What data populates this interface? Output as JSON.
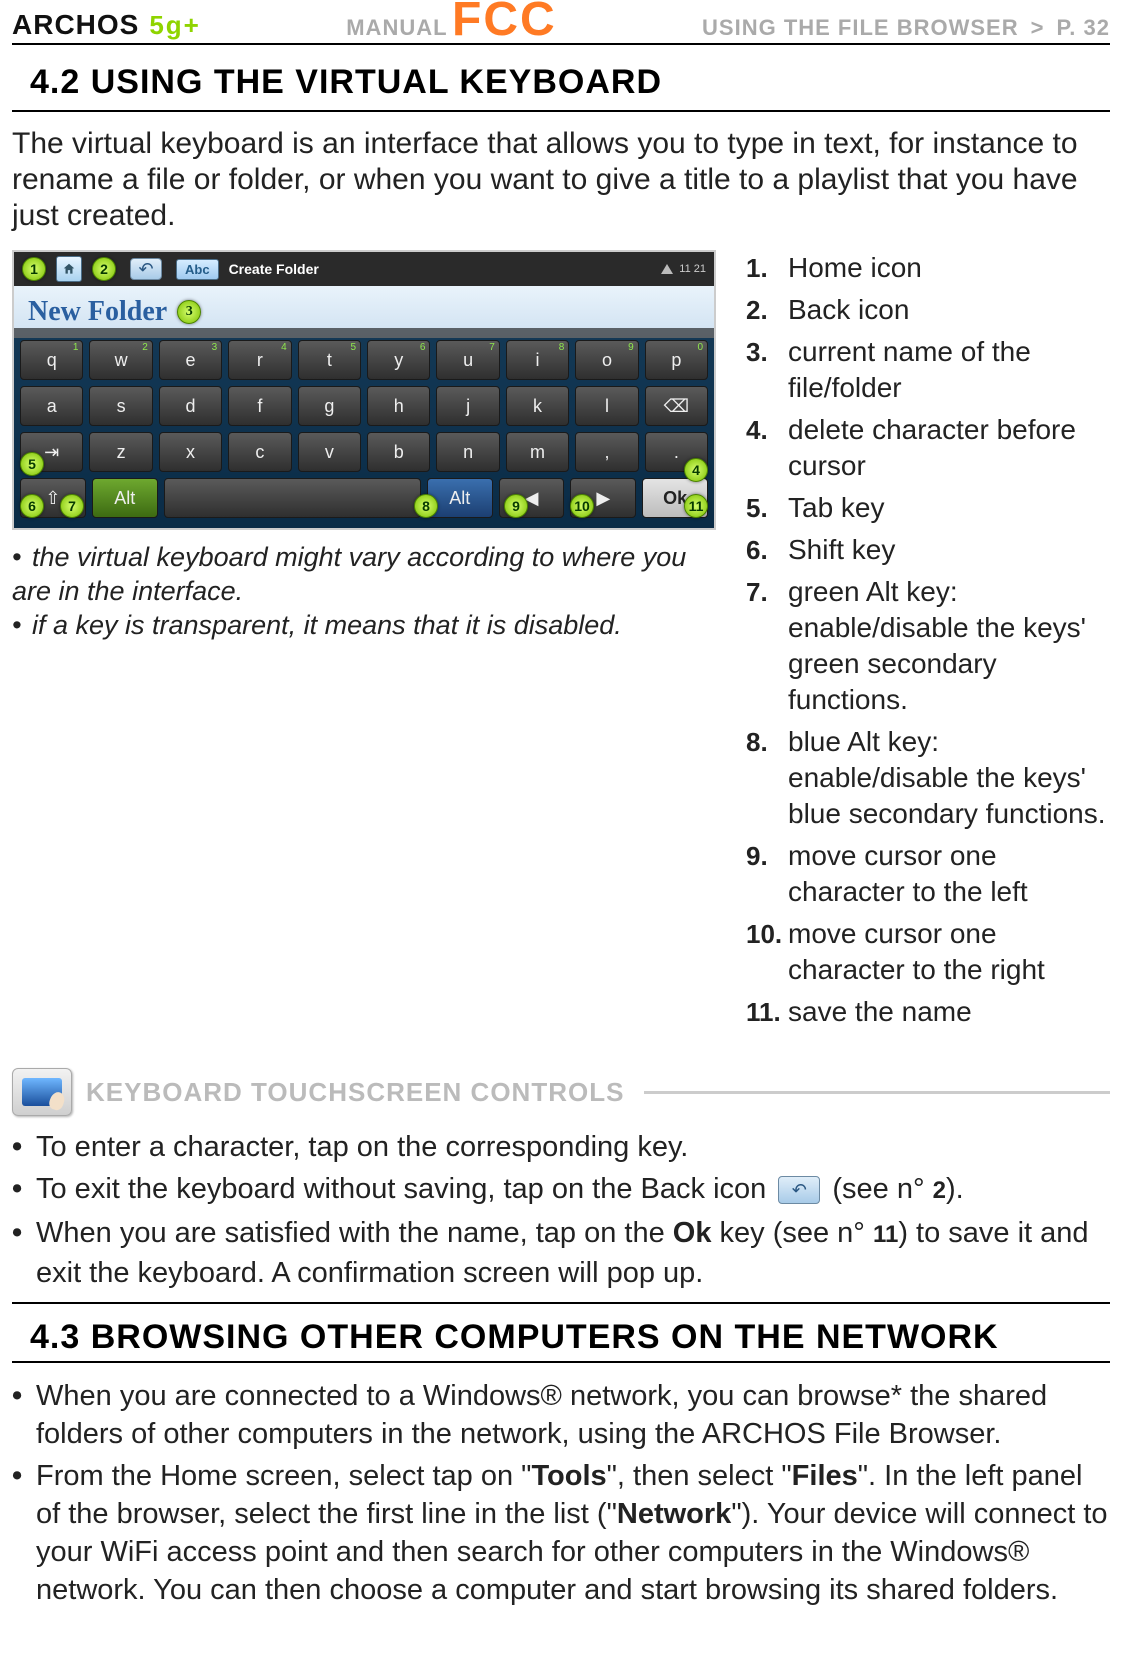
{
  "header": {
    "brand": "ARCHOS",
    "model": "5g+",
    "manual": "MANUAL",
    "fcc": "FCC",
    "breadcrumb": "USING THE FILE BROWSER",
    "gt": ">",
    "page": "P. 32"
  },
  "section42": {
    "title": "4.2 USING THE VIRTUAL KEYBOARD",
    "lead": "The virtual keyboard is an interface that allows you to type in text, for instance to rename a file or folder, or when you want to give a title to a playlist that you have just created."
  },
  "kb": {
    "title": "Create Folder",
    "abc": "Abc",
    "name": "New Folder",
    "time": "11 21",
    "rows": {
      "r1": [
        "q",
        "w",
        "e",
        "r",
        "t",
        "y",
        "u",
        "i",
        "o",
        "p"
      ],
      "r1sup": [
        "1",
        "2",
        "3",
        "4",
        "5",
        "6",
        "7",
        "8",
        "9",
        "0"
      ],
      "r2": [
        "a",
        "s",
        "d",
        "f",
        "g",
        "h",
        "j",
        "k",
        "l"
      ],
      "r3": [
        "z",
        "x",
        "c",
        "v",
        "b",
        "n",
        "m"
      ],
      "alt": "Alt",
      "altB": "Alt",
      "ok": "Ok"
    }
  },
  "notes": {
    "n1": "the virtual keyboard might vary according to where you are in the interface.",
    "n2": "if a key is transparent, it means that it is disabled."
  },
  "callouts": [
    {
      "n": "1.",
      "t": "Home icon"
    },
    {
      "n": "2.",
      "t": "Back icon"
    },
    {
      "n": "3.",
      "t": "current name of the file/folder"
    },
    {
      "n": "4.",
      "t": "delete character before cursor"
    },
    {
      "n": "5.",
      "t": "Tab key"
    },
    {
      "n": "6.",
      "t": "Shift key"
    },
    {
      "n": "7.",
      "t": "green Alt key: enable/disable the keys' green secondary functions."
    },
    {
      "n": "8.",
      "t": "blue Alt key: enable/disable the keys' blue secondary functions."
    },
    {
      "n": "9.",
      "t": "move cursor one character to the left"
    },
    {
      "n": "10.",
      "t": "move cursor one character to the right"
    },
    {
      "n": "11.",
      "t": "save the name"
    }
  ],
  "ts": {
    "title": "KEYBOARD TOUCHSCREEN CONTROLS",
    "b1": "To enter a character, tap on the corresponding key.",
    "b2a": "To exit the keyboard without saving, tap on the Back icon ",
    "b2b": " (see n° ",
    "b2num": "2",
    "b2c": ").",
    "b3a": "When you are satisfied with the name, tap on the ",
    "b3ok": "Ok",
    "b3b": " key (see n° ",
    "b3num": "11",
    "b3c": ") to save it and exit the keyboard. A confirmation screen will pop up."
  },
  "section43": {
    "title": "4.3 BROWSING OTHER COMPUTERS ON THE NETWORK",
    "b1": "When you are connected to a Windows® network, you can browse* the shared folders of other computers in the network, using the ARCHOS File Browser.",
    "b2a": "From the Home screen, select tap on \"",
    "b2tools": "Tools",
    "b2b": "\", then select \"",
    "b2files": "Files",
    "b2c": "\". In the left panel of the browser, select the first line in the list (\"",
    "b2net": "Network",
    "b2d": "\"). Your device will connect to your WiFi access point and then search for other computers in the Windows® network. You can then choose a computer and start browsing its shared folders."
  }
}
